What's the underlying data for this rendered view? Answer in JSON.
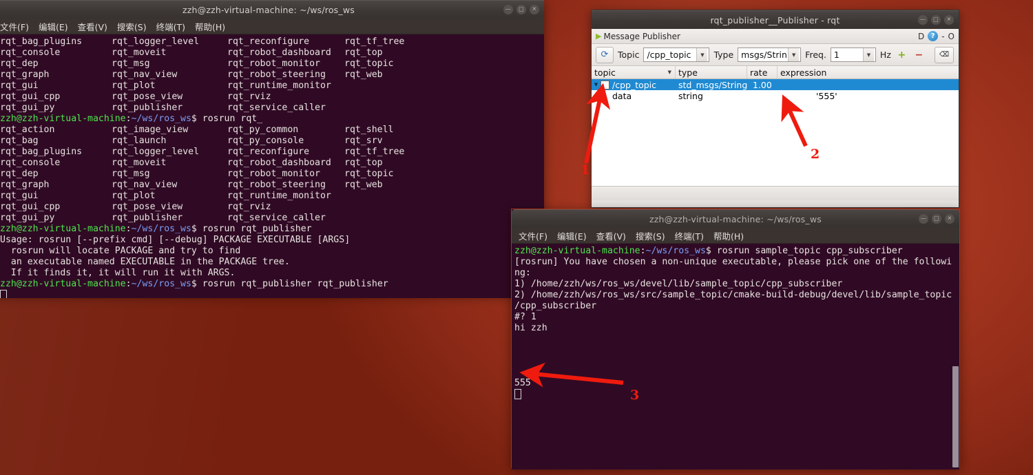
{
  "desktop": {
    "background_color": "#8e2b15"
  },
  "terminal1": {
    "title": "zzh@zzh-virtual-machine: ~/ws/ros_ws",
    "window_buttons": [
      "minimize",
      "maximize",
      "close"
    ],
    "menu": [
      "文件(F)",
      "编辑(E)",
      "查看(V)",
      "搜索(S)",
      "终端(T)",
      "帮助(H)"
    ],
    "columns_block_1": [
      [
        "rqt_bag_plugins",
        "rqt_logger_level",
        "rqt_reconfigure",
        "rqt_tf_tree"
      ],
      [
        "rqt_console",
        "rqt_moveit",
        "rqt_robot_dashboard",
        "rqt_top"
      ],
      [
        "rqt_dep",
        "rqt_msg",
        "rqt_robot_monitor",
        "rqt_topic"
      ],
      [
        "rqt_graph",
        "rqt_nav_view",
        "rqt_robot_steering",
        "rqt_web"
      ],
      [
        "rqt_gui",
        "rqt_plot",
        "rqt_runtime_monitor",
        ""
      ],
      [
        "rqt_gui_cpp",
        "rqt_pose_view",
        "rqt_rviz",
        ""
      ],
      [
        "rqt_gui_py",
        "rqt_publisher",
        "rqt_service_caller",
        ""
      ]
    ],
    "prompt1": {
      "user": "zzh@zzh-virtual-machine",
      "sep": ":",
      "path": "~/ws/ros_ws",
      "cmd": "$ rosrun rqt_"
    },
    "columns_block_2": [
      [
        "rqt_action",
        "rqt_image_view",
        "rqt_py_common",
        "rqt_shell"
      ],
      [
        "rqt_bag",
        "rqt_launch",
        "rqt_py_console",
        "rqt_srv"
      ],
      [
        "rqt_bag_plugins",
        "rqt_logger_level",
        "rqt_reconfigure",
        "rqt_tf_tree"
      ],
      [
        "rqt_console",
        "rqt_moveit",
        "rqt_robot_dashboard",
        "rqt_top"
      ],
      [
        "rqt_dep",
        "rqt_msg",
        "rqt_robot_monitor",
        "rqt_topic"
      ],
      [
        "rqt_graph",
        "rqt_nav_view",
        "rqt_robot_steering",
        "rqt_web"
      ],
      [
        "rqt_gui",
        "rqt_plot",
        "rqt_runtime_monitor",
        ""
      ],
      [
        "rqt_gui_cpp",
        "rqt_pose_view",
        "rqt_rviz",
        ""
      ],
      [
        "rqt_gui_py",
        "rqt_publisher",
        "rqt_service_caller",
        ""
      ]
    ],
    "prompt2": {
      "user": "zzh@zzh-virtual-machine",
      "sep": ":",
      "path": "~/ws/ros_ws",
      "cmd": "$ rosrun rqt_publisher"
    },
    "usage_lines": [
      "Usage: rosrun [--prefix cmd] [--debug] PACKAGE EXECUTABLE [ARGS]",
      "  rosrun will locate PACKAGE and try to find",
      "  an executable named EXECUTABLE in the PACKAGE tree.",
      "  If it finds it, it will run it with ARGS."
    ],
    "prompt3": {
      "user": "zzh@zzh-virtual-machine",
      "sep": ":",
      "path": "~/ws/ros_ws",
      "cmd": "$ rosrun rqt_publisher rqt_publisher"
    }
  },
  "rqt": {
    "title": "rqt_publisher__Publisher - rqt",
    "window_buttons": [
      "minimize",
      "maximize",
      "close"
    ],
    "dock": {
      "title": "Message Publisher",
      "right_controls": [
        "D",
        "?",
        "-",
        "O"
      ]
    },
    "toolbar": {
      "refresh_icon": "refresh-icon",
      "topic_label": "Topic",
      "topic_value": "/cpp_topic",
      "type_label": "Type",
      "type_value": "msgs/String",
      "freq_label": "Freq.",
      "freq_value": "1",
      "hz_label": "Hz",
      "add_label": "+",
      "remove_label": "−",
      "clear_icon": "clear-backspace-icon"
    },
    "table": {
      "headers": [
        "topic",
        "type",
        "rate",
        "expression"
      ],
      "rows": [
        {
          "selected": true,
          "expander": "▼",
          "checkbox": true,
          "topic": "/cpp_topic",
          "type": "std_msgs/String",
          "rate": "1.00",
          "expression": ""
        },
        {
          "selected": false,
          "expander": "",
          "checkbox": false,
          "topic": "data",
          "type": "string",
          "rate": "",
          "expression": "'555'"
        }
      ]
    }
  },
  "terminal2": {
    "title": "zzh@zzh-virtual-machine: ~/ws/ros_ws",
    "window_buttons": [
      "minimize",
      "maximize",
      "close"
    ],
    "menu": [
      "文件(F)",
      "编辑(E)",
      "查看(V)",
      "搜索(S)",
      "终端(T)",
      "帮助(H)"
    ],
    "prompt": {
      "user": "zzh@zzh-virtual-machine",
      "sep": ":",
      "path": "~/ws/ros_ws",
      "cmd": "$ rosrun sample_topic cpp_subscriber"
    },
    "lines": [
      "[rosrun] You have chosen a non-unique executable, please pick one of the followi",
      "ng:",
      "1) /home/zzh/ws/ros_ws/devel/lib/sample_topic/cpp_subscriber",
      "2) /home/zzh/ws/ros_ws/src/sample_topic/cmake-build-debug/devel/lib/sample_topic",
      "/cpp_subscriber",
      "#? 1",
      "hi zzh"
    ],
    "blank_lines": 4,
    "output": "555"
  },
  "annotations": {
    "accent_color": "#ef1b0e",
    "markers": [
      {
        "label": "1",
        "points_to": "tree-expander-toggle"
      },
      {
        "label": "2",
        "points_to": "expression-value-cell"
      },
      {
        "label": "3",
        "points_to": "subscriber-output-555"
      }
    ]
  }
}
